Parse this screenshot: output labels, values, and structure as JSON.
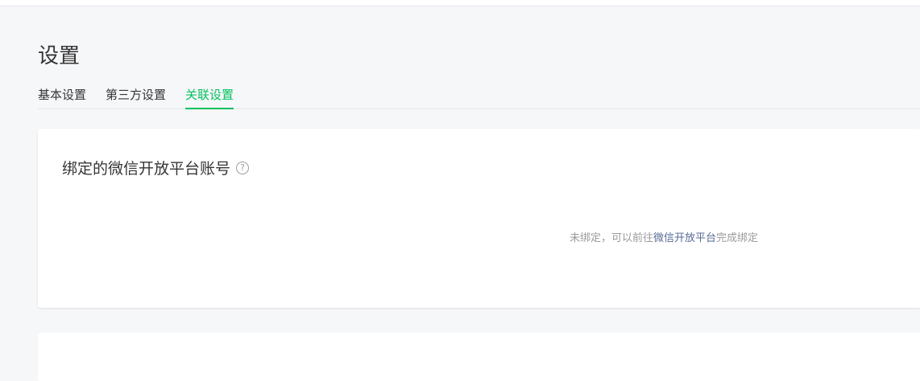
{
  "page": {
    "title": "设置"
  },
  "tabs": [
    {
      "label": "基本设置",
      "active": false
    },
    {
      "label": "第三方设置",
      "active": false
    },
    {
      "label": "关联设置",
      "active": true
    }
  ],
  "bound_account_card": {
    "title": "绑定的微信开放平台账号",
    "help_icon": "question-circle-icon",
    "empty_hint_prefix": "未绑定，可以前往",
    "empty_hint_link": "微信开放平台",
    "empty_hint_suffix": "完成绑定"
  },
  "colors": {
    "accent": "#07c160",
    "link": "#576b95",
    "background": "#f6f7f9"
  }
}
